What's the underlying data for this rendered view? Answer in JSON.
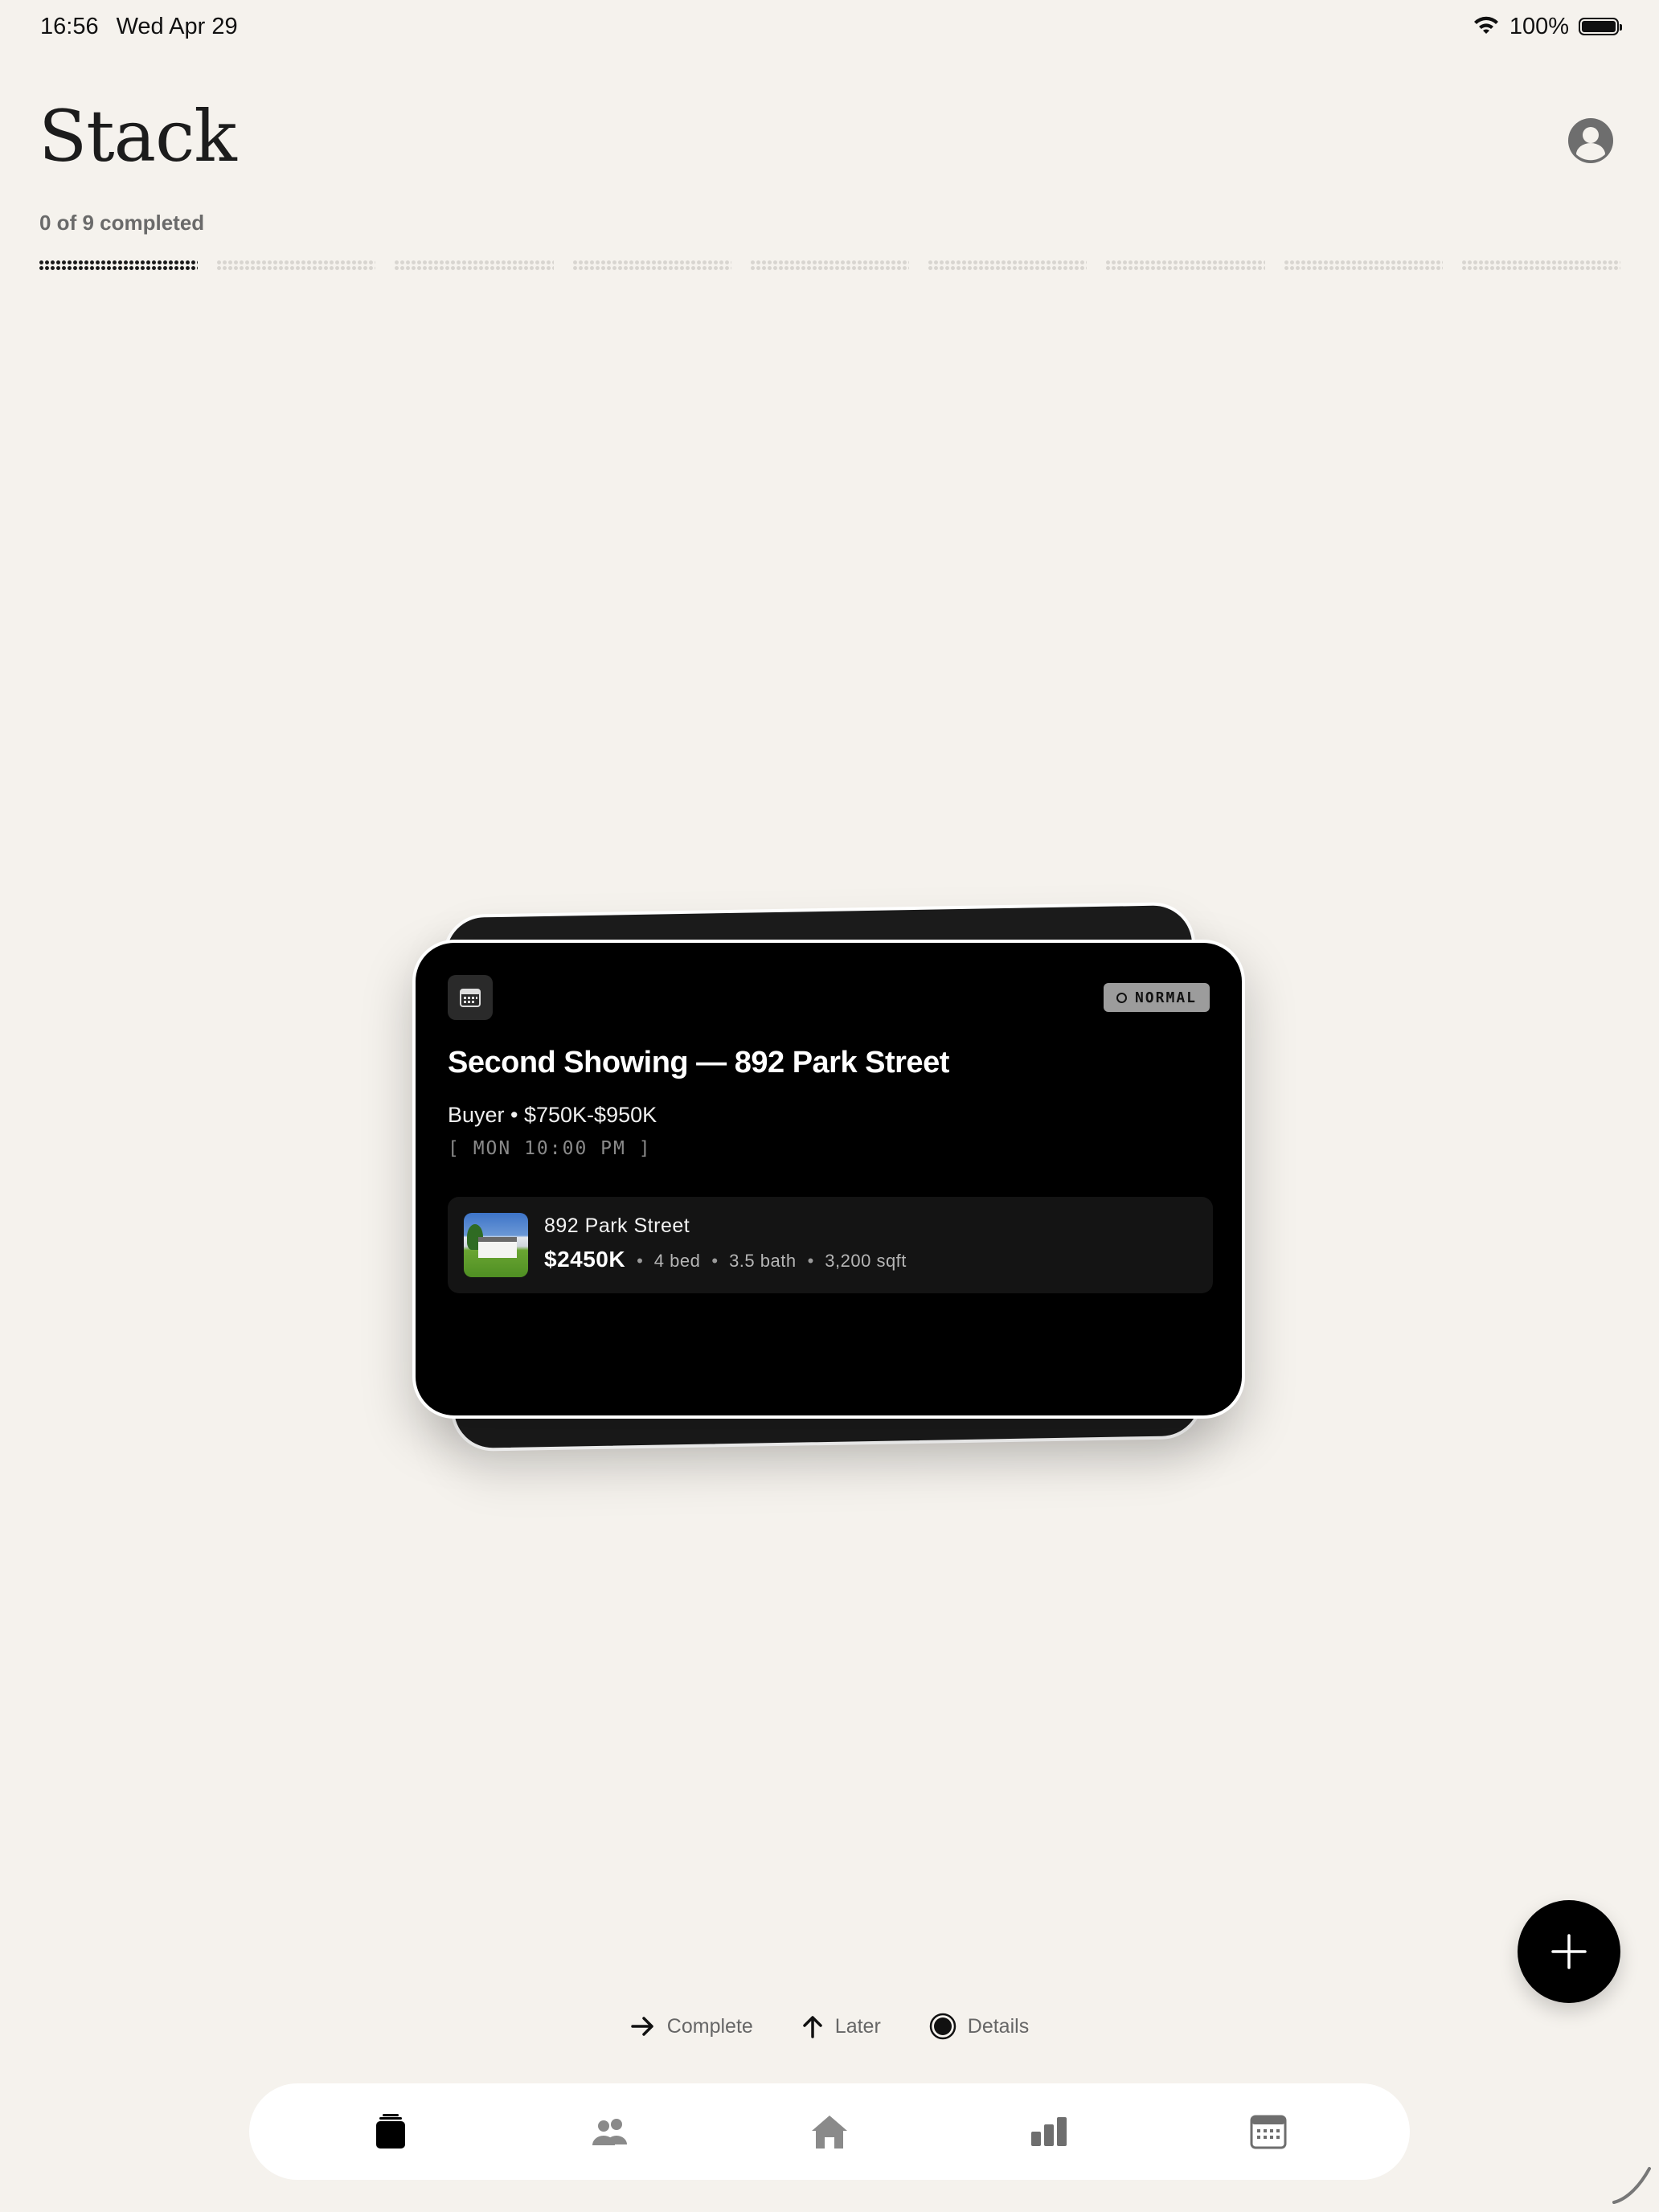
{
  "status_bar": {
    "time": "16:56",
    "date": "Wed Apr 29",
    "battery": "100%"
  },
  "header": {
    "title": "Stack",
    "progress_text": "0 of 9 completed",
    "total_segments": 9,
    "active_segment": 1
  },
  "card": {
    "icon": "calendar-icon",
    "priority": "NORMAL",
    "title": "Second Showing — 892 Park Street",
    "subtitle": "Buyer • $750K-$950K",
    "time": "[ MON 10:00 PM ]",
    "property": {
      "address": "892 Park Street",
      "price": "$2450K",
      "beds": "4 bed",
      "baths": "3.5 bath",
      "sqft": "3,200 sqft"
    }
  },
  "hints": {
    "complete": "Complete",
    "later": "Later",
    "details": "Details"
  },
  "tabs": [
    {
      "name": "stack",
      "icon": "stack-icon",
      "active": true
    },
    {
      "name": "people",
      "icon": "people-icon",
      "active": false
    },
    {
      "name": "home",
      "icon": "house-icon",
      "active": false
    },
    {
      "name": "stats",
      "icon": "bar-chart-icon",
      "active": false
    },
    {
      "name": "calendar",
      "icon": "calendar-icon",
      "active": false
    }
  ],
  "colors": {
    "background": "#f5f2ed",
    "card": "#000000",
    "accent": "#000000",
    "badge": "#9c9c9c",
    "muted": "#6a6a6a"
  }
}
